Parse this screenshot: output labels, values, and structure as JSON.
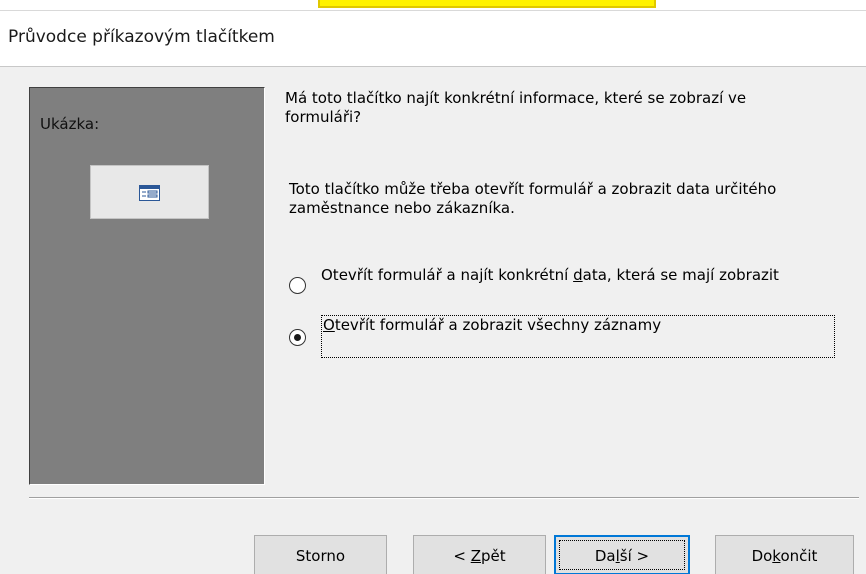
{
  "window": {
    "title": "Průvodce příkazovým tlačítkem"
  },
  "preview": {
    "label": "Ukázka:",
    "button_icon": "form-icon"
  },
  "content": {
    "question": "Má toto tlačítko najít konkrétní informace, které se zobrazí ve formuláři?",
    "explanation": "Toto tlačítko může třeba otevřít formulář a zobrazit data určitého zaměstnance nebo zákazníka.",
    "options": [
      {
        "label_pre": "Otevřít formulář a najít konkrétní ",
        "label_accel": "d",
        "label_post": "ata, která se mají zobrazit",
        "selected": false
      },
      {
        "label_pre": "",
        "label_accel": "O",
        "label_post": "tevřít formulář a zobrazit všechny záznamy",
        "selected": true
      }
    ]
  },
  "buttons": {
    "cancel": "Storno",
    "back_pre": "< ",
    "back_accel": "Z",
    "back_post": "pět",
    "next_pre": "Da",
    "next_accel": "l",
    "next_post": "ší >",
    "finish_pre": "Do",
    "finish_accel": "k",
    "finish_post": "ončit"
  },
  "colors": {
    "highlight": "#fff200",
    "accent_focus": "#0078d7",
    "preview_bg": "#7f7f7f"
  }
}
